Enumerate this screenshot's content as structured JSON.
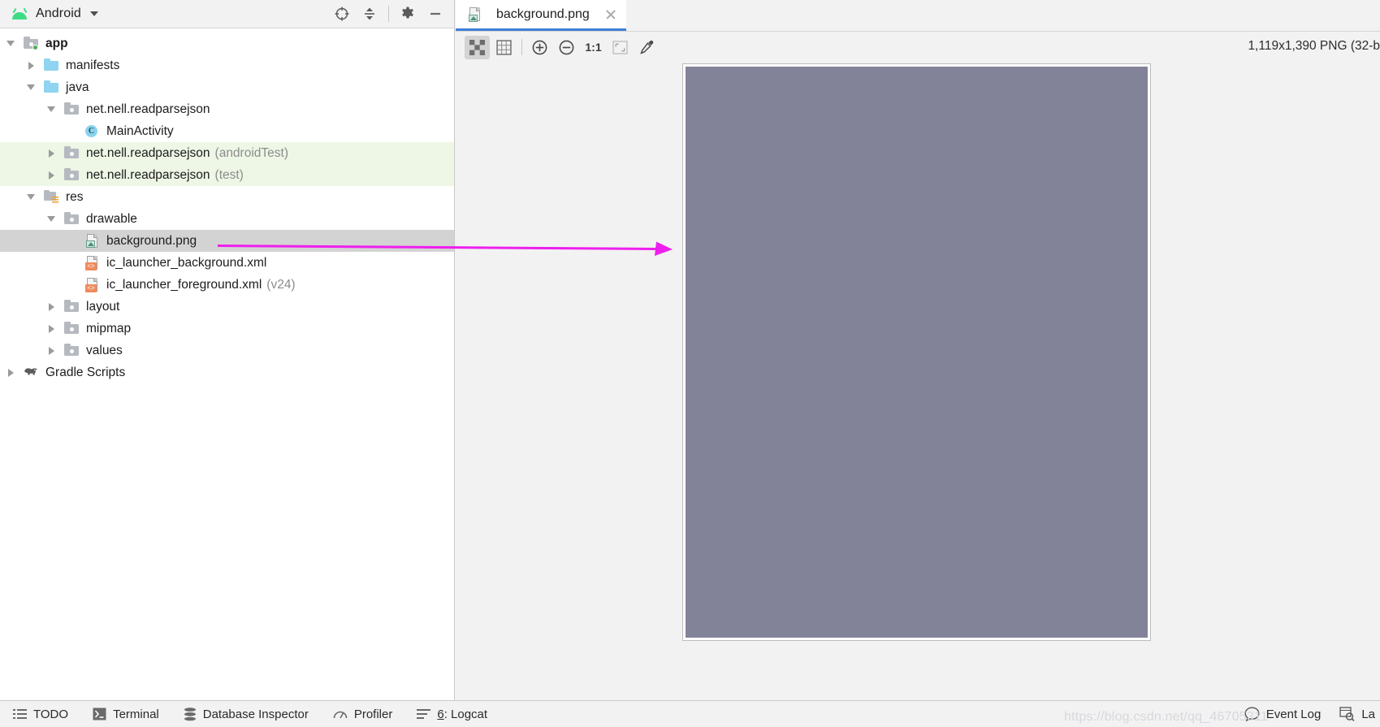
{
  "window": {
    "project_panel_title": "Android",
    "panel_icon": "android-logo-icon"
  },
  "panel_toolbar": {
    "locate_label": "locate-icon",
    "collapse_label": "collapse-all-icon",
    "settings_label": "gear-icon",
    "minimize_label": "minimize-icon"
  },
  "tree": [
    {
      "indent": 0,
      "arrow": "open",
      "icon": "module",
      "label": "app",
      "suffix": "",
      "bold": true,
      "state": ""
    },
    {
      "indent": 1,
      "arrow": "closed",
      "icon": "folder-blue",
      "label": "manifests",
      "suffix": "",
      "bold": false,
      "state": ""
    },
    {
      "indent": 1,
      "arrow": "open",
      "icon": "folder-blue",
      "label": "java",
      "suffix": "",
      "bold": false,
      "state": ""
    },
    {
      "indent": 2,
      "arrow": "open",
      "icon": "folder-gray",
      "label": "net.nell.readparsejson",
      "suffix": "",
      "bold": false,
      "state": ""
    },
    {
      "indent": 3,
      "arrow": "none",
      "icon": "class-c",
      "label": "MainActivity",
      "suffix": "",
      "bold": false,
      "state": ""
    },
    {
      "indent": 2,
      "arrow": "closed",
      "icon": "folder-gray",
      "label": "net.nell.readparsejson",
      "suffix": "(androidTest)",
      "bold": false,
      "state": "green"
    },
    {
      "indent": 2,
      "arrow": "closed",
      "icon": "folder-gray",
      "label": "net.nell.readparsejson",
      "suffix": "(test)",
      "bold": false,
      "state": "green"
    },
    {
      "indent": 1,
      "arrow": "open",
      "icon": "folder-res",
      "label": "res",
      "suffix": "",
      "bold": false,
      "state": ""
    },
    {
      "indent": 2,
      "arrow": "open",
      "icon": "folder-gray",
      "label": "drawable",
      "suffix": "",
      "bold": false,
      "state": ""
    },
    {
      "indent": 3,
      "arrow": "none",
      "icon": "png-file",
      "label": "background.png",
      "suffix": "",
      "bold": false,
      "state": "selected"
    },
    {
      "indent": 3,
      "arrow": "none",
      "icon": "xml-file",
      "label": "ic_launcher_background.xml",
      "suffix": "",
      "bold": false,
      "state": ""
    },
    {
      "indent": 3,
      "arrow": "none",
      "icon": "xml-file",
      "label": "ic_launcher_foreground.xml",
      "suffix": "(v24)",
      "bold": false,
      "state": ""
    },
    {
      "indent": 2,
      "arrow": "closed",
      "icon": "folder-gray",
      "label": "layout",
      "suffix": "",
      "bold": false,
      "state": ""
    },
    {
      "indent": 2,
      "arrow": "closed",
      "icon": "folder-gray",
      "label": "mipmap",
      "suffix": "",
      "bold": false,
      "state": ""
    },
    {
      "indent": 2,
      "arrow": "closed",
      "icon": "folder-gray",
      "label": "values",
      "suffix": "",
      "bold": false,
      "state": ""
    },
    {
      "indent": 0,
      "arrow": "closed",
      "icon": "gradle",
      "label": "Gradle Scripts",
      "suffix": "",
      "bold": false,
      "state": ""
    }
  ],
  "editor": {
    "tab": {
      "title": "background.png",
      "icon": "png-file-icon",
      "close_icon": "close-icon"
    },
    "image_info": "1,119x1,390 PNG (32-b",
    "image_color": "#828399",
    "toolbar": [
      {
        "name": "toggle-transparency-chessboard",
        "kind": "checker",
        "label": "",
        "active": true
      },
      {
        "name": "toggle-grid",
        "kind": "grid",
        "label": "",
        "active": false
      },
      {
        "name": "zoom-in",
        "kind": "plus",
        "label": "",
        "active": false
      },
      {
        "name": "zoom-out",
        "kind": "minus",
        "label": "",
        "active": false
      },
      {
        "name": "actual-size",
        "kind": "text",
        "label": "1:1",
        "active": false
      },
      {
        "name": "fit-to-window",
        "kind": "fit",
        "label": "",
        "active": false
      },
      {
        "name": "color-picker",
        "kind": "picker",
        "label": "",
        "active": false
      }
    ]
  },
  "statusbar": {
    "items": [
      {
        "label": "TODO",
        "icon": "todo-icon",
        "underline": ""
      },
      {
        "label": "Terminal",
        "icon": "terminal-icon",
        "underline": ""
      },
      {
        "label": "Database Inspector",
        "icon": "database-icon",
        "underline": ""
      },
      {
        "label": "Profiler",
        "icon": "profiler-icon",
        "underline": ""
      },
      {
        "label": ": Logcat",
        "icon": "logcat-icon",
        "underline": "6"
      }
    ],
    "right": [
      {
        "label": "Event Log",
        "icon": "balloon-icon"
      },
      {
        "label": "La",
        "icon": "layout-inspector-icon"
      }
    ]
  },
  "annotation": {
    "arrow_color": "#ee1fee",
    "watermark": "https://blog.csdn.net/qq_46705311"
  }
}
